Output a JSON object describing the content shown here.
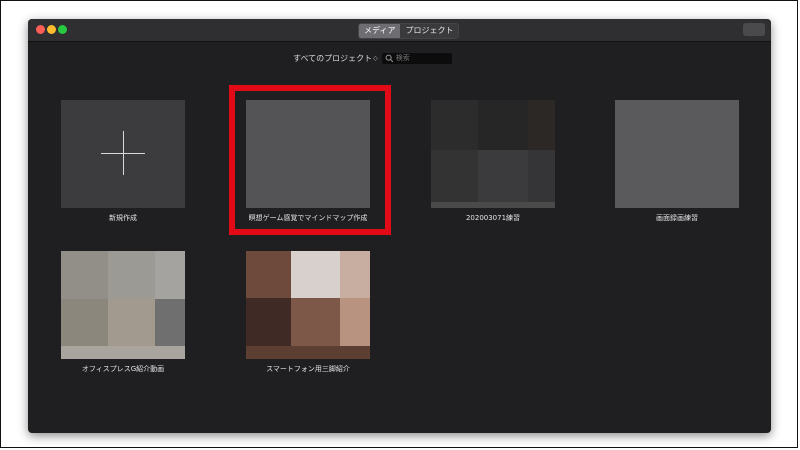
{
  "titlebar": {
    "tabs": [
      {
        "label": "メディア",
        "active": true
      },
      {
        "label": "プロジェクト",
        "active": false
      }
    ]
  },
  "filter": {
    "label": "すべてのプロジェクト",
    "caret": "◇",
    "search_placeholder": "検索"
  },
  "projects": [
    {
      "title": "新規作成"
    },
    {
      "title": "瞑想ゲーム感覚でマインドマップ作成",
      "highlighted": true
    },
    {
      "title": "202003071練習"
    },
    {
      "title": "画面録画練習"
    },
    {
      "title": "オフィスプレスG紹介動画"
    },
    {
      "title": "スマートフォン用三脚紹介"
    }
  ],
  "colors": {
    "highlight": "#e20a17",
    "window_background": "#1f1f21"
  }
}
